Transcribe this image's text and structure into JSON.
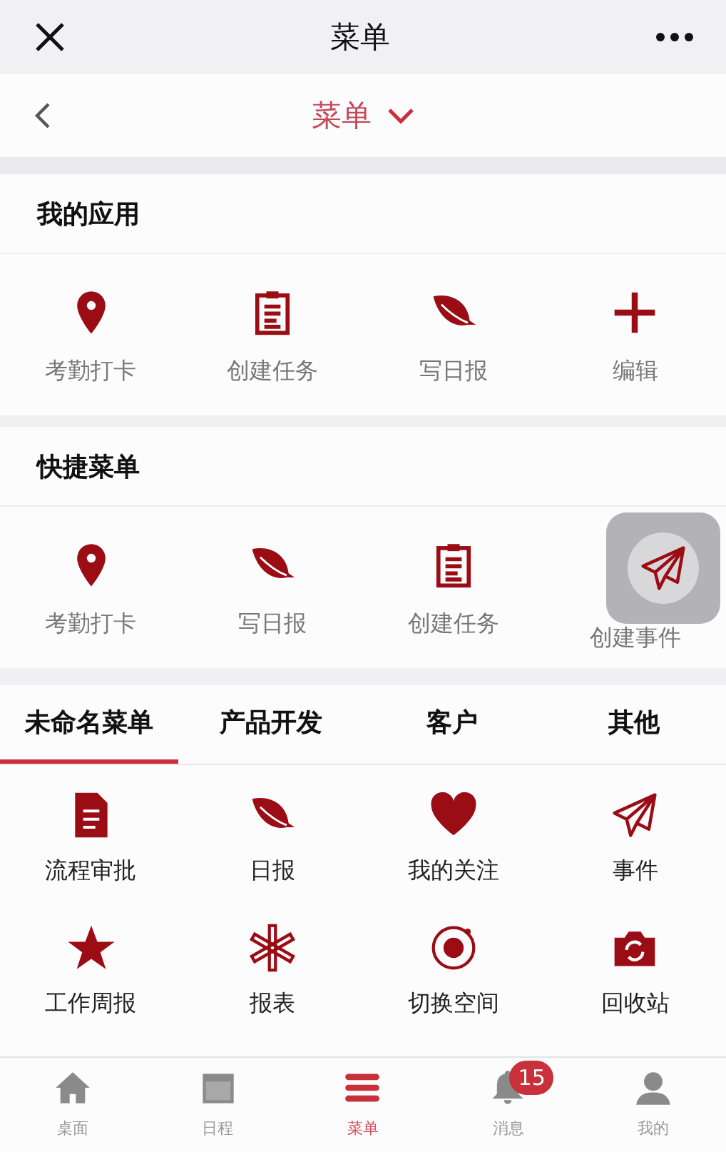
{
  "header": {
    "title": "菜单"
  },
  "nav": {
    "title": "菜单"
  },
  "sections": [
    {
      "title": "我的应用",
      "items": [
        {
          "label": "考勤打卡",
          "kind": "pin"
        },
        {
          "label": "创建任务",
          "kind": "clipboard"
        },
        {
          "label": "写日报",
          "kind": "leaf"
        },
        {
          "label": "编辑",
          "kind": "plus"
        }
      ]
    },
    {
      "title": "快捷菜单",
      "items": [
        {
          "label": "考勤打卡",
          "kind": "pin"
        },
        {
          "label": "写日报",
          "kind": "leaf"
        },
        {
          "label": "创建任务",
          "kind": "clipboard"
        },
        {
          "label": "创建事件",
          "kind": "plane"
        }
      ]
    }
  ],
  "menu_tabs": [
    {
      "label": "未命名菜单",
      "selected": true
    },
    {
      "label": "产品开发",
      "selected": false
    },
    {
      "label": "客户",
      "selected": false
    },
    {
      "label": "其他",
      "selected": false
    }
  ],
  "menu_items": [
    {
      "label": "流程审批",
      "kind": "doc"
    },
    {
      "label": "日报",
      "kind": "leaf"
    },
    {
      "label": "我的关注",
      "kind": "heart"
    },
    {
      "label": "事件",
      "kind": "plane"
    },
    {
      "label": "工作周报",
      "kind": "star"
    },
    {
      "label": "报表",
      "kind": "asterisk"
    },
    {
      "label": "切换空间",
      "kind": "target"
    },
    {
      "label": "回收站",
      "kind": "camera"
    }
  ],
  "bottom_nav": [
    {
      "label": "桌面",
      "kind": "home",
      "selected": false
    },
    {
      "label": "日程",
      "kind": "calendar",
      "selected": false
    },
    {
      "label": "菜单",
      "kind": "menu",
      "selected": true
    },
    {
      "label": "消息",
      "kind": "bell",
      "selected": false,
      "badge": "15"
    },
    {
      "label": "我的",
      "kind": "person",
      "selected": false
    }
  ]
}
